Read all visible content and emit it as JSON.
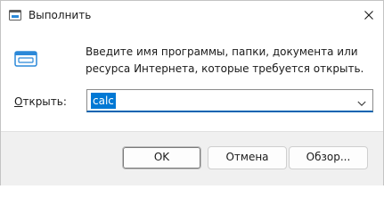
{
  "window": {
    "title": "Выполнить",
    "close_icon": "close-icon"
  },
  "body": {
    "description": "Введите имя программы, папки, документа или ресурса Интернета, которые требуется открыть.",
    "open_label_accel": "О",
    "open_label_rest": "ткрыть:",
    "input_value": "calc"
  },
  "buttons": {
    "ok": "OK",
    "cancel": "Отмена",
    "browse": "Обзор..."
  },
  "colors": {
    "accent": "#0078d4",
    "footer_bg": "#f0f0f0",
    "run_icon_blue": "#2b88d8"
  }
}
